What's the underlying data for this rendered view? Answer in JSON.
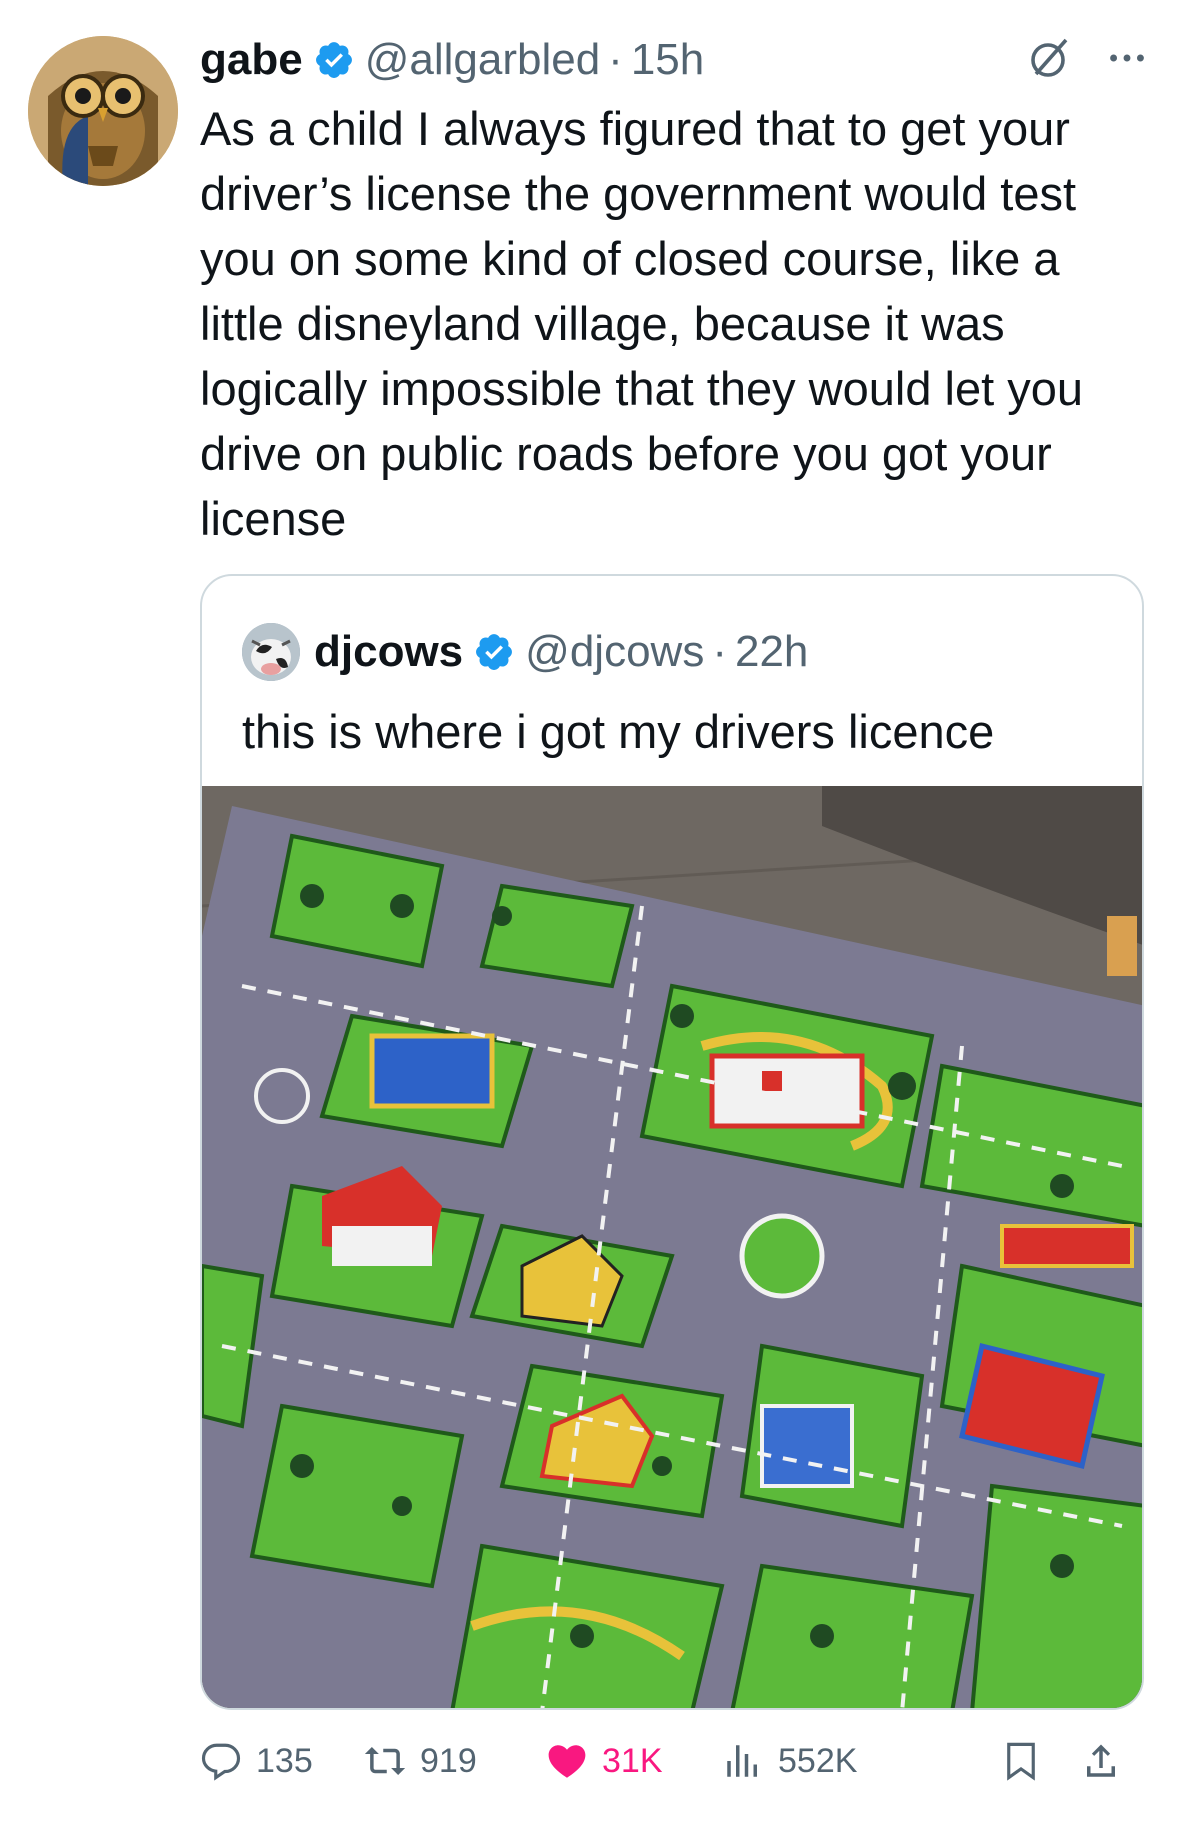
{
  "tweet": {
    "author": {
      "display_name": "gabe",
      "handle": "@allgarbled",
      "verified": true,
      "avatar_icon": "owl-avatar"
    },
    "separator": "·",
    "time": "15h",
    "text": "As a child I always figured that to get your driver’s license the government would test you on some kind of closed course, like a little disneyland village, because it was logically impossible that they would let you drive on public roads before you got your license"
  },
  "quote": {
    "author": {
      "display_name": "djcows",
      "handle": "@djcows",
      "verified": true,
      "avatar_icon": "cow-avatar"
    },
    "separator": "·",
    "time": "22h",
    "text": "this is where i got my drivers licence",
    "image_subject": "children's road play mat on wooden floor"
  },
  "actions": {
    "replies": "135",
    "reposts": "919",
    "likes": "31K",
    "views": "552K"
  },
  "colors": {
    "verified_blue": "#1d9bf0",
    "like_pink": "#f91880",
    "muted_text": "#536471",
    "border": "#cfd9de"
  }
}
